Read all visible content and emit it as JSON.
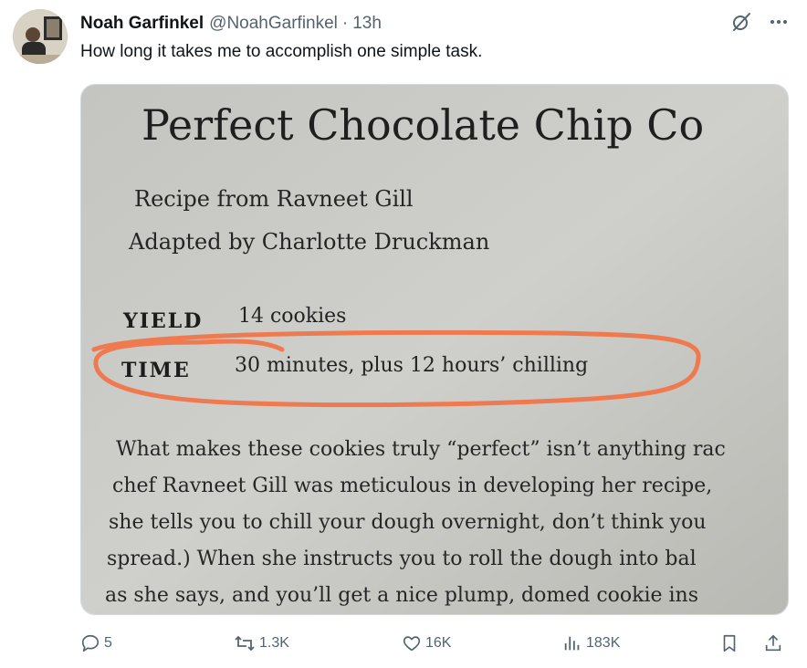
{
  "tweet": {
    "author_name": "Noah Garfinkel",
    "handle": "@NoahGarfinkel",
    "separator": "·",
    "time": "13h",
    "text": "How long it takes me to accomplish one simple task."
  },
  "media": {
    "title": "Perfect Chocolate Chip Co",
    "credit_1": "Recipe from Ravneet Gill",
    "credit_2": "Adapted by Charlotte Druckman",
    "yield_label": "YIELD",
    "yield_value": "14 cookies",
    "time_label": "TIME",
    "time_value": "30 minutes, plus 12 hours’ chilling",
    "body_lines": [
      "What makes these cookies truly “perfect” isn’t anything rac",
      "chef Ravneet Gill was meticulous in developing her recipe,",
      "she tells you to chill your dough overnight, don’t think you",
      "spread.) When she instructs you to roll the dough into bal",
      "as she says, and you’ll get a nice plump, domed cookie ins"
    ],
    "highlight_color": "#f07a4f"
  },
  "actions": {
    "replies": "5",
    "reposts": "1.3K",
    "likes": "16K",
    "views": "183K"
  },
  "icons": {
    "grok": "grok-icon",
    "more": "more-icon",
    "reply": "reply-icon",
    "repost": "repost-icon",
    "like": "like-icon",
    "views": "views-icon",
    "bookmark": "bookmark-icon",
    "share": "share-icon"
  }
}
